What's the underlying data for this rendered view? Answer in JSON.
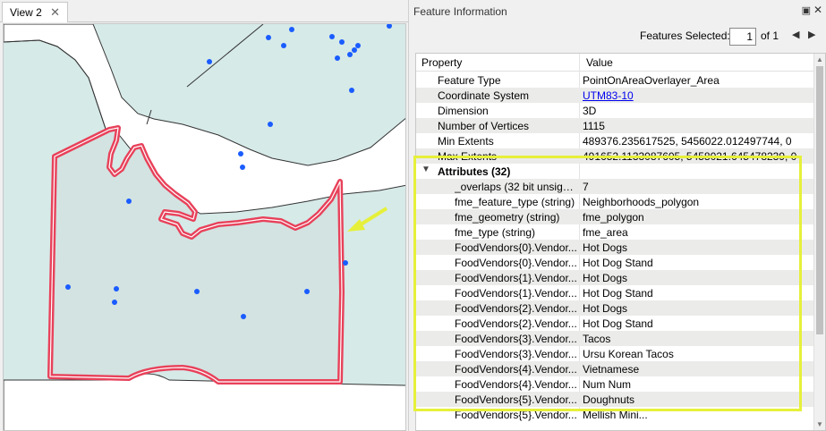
{
  "view": {
    "tab_label": "View 2",
    "close_glyph": "✕"
  },
  "panel": {
    "title": "Feature Information",
    "pin_glyph": "▣",
    "close_glyph": "✕",
    "features_selected_label": "Features Selected:",
    "features_selected_value": "1",
    "of_label": "of 1",
    "prev_glyph": "◀",
    "next_glyph": "▶",
    "icons": {
      "pin": "pin-icon",
      "close": "close-icon",
      "prev": "previous-icon",
      "next": "next-icon",
      "arrow": "arrow-icon"
    }
  },
  "table": {
    "col_property": "Property",
    "col_value": "Value",
    "rows": [
      {
        "key": "Feature Type",
        "value": "PointOnAreaOverlayer_Area"
      },
      {
        "key": "Coordinate System",
        "value": "UTM83-10"
      },
      {
        "key": "Dimension",
        "value": "3D"
      },
      {
        "key": "Number of Vertices",
        "value": "1115"
      },
      {
        "key": "Min Extents",
        "value": "489376.235617525, 5456022.012497744, 0"
      },
      {
        "key": "Max Extents",
        "value": "491652.1133087605, 5458021.645478239, 0"
      }
    ],
    "attributes_group": "Attributes (32)",
    "attributes": [
      {
        "key": "_overlaps (32 bit unsign...",
        "value": "7"
      },
      {
        "key": "fme_feature_type (string)",
        "value": "Neighborhoods_polygon"
      },
      {
        "key": "fme_geometry (string)",
        "value": "fme_polygon"
      },
      {
        "key": "fme_type (string)",
        "value": "fme_area"
      },
      {
        "key": "FoodVendors{0}.Vendor...",
        "value": "Hot Dogs"
      },
      {
        "key": "FoodVendors{0}.Vendor...",
        "value": "Hot Dog Stand"
      },
      {
        "key": "FoodVendors{1}.Vendor...",
        "value": "Hot Dogs"
      },
      {
        "key": "FoodVendors{1}.Vendor...",
        "value": "Hot Dog Stand"
      },
      {
        "key": "FoodVendors{2}.Vendor...",
        "value": "Hot Dogs"
      },
      {
        "key": "FoodVendors{2}.Vendor...",
        "value": "Hot Dog Stand"
      },
      {
        "key": "FoodVendors{3}.Vendor...",
        "value": "Tacos"
      },
      {
        "key": "FoodVendors{3}.Vendor...",
        "value": "Ursu Korean Tacos"
      },
      {
        "key": "FoodVendors{4}.Vendor...",
        "value": "Vietnamese"
      },
      {
        "key": "FoodVendors{4}.Vendor...",
        "value": "Num Num"
      },
      {
        "key": "FoodVendors{5}.Vendor...",
        "value": "Doughnuts"
      },
      {
        "key": "FoodVendors{5}.Vendor...",
        "value": "Mellish Mini..."
      }
    ]
  },
  "colors": {
    "land": "#d6eae8",
    "water": "#ffffff",
    "polygon_outline": "#e8415a",
    "polygon_fill": "#d3e3e1",
    "point": "#1a5cff",
    "highlight": "#e6f03a",
    "arrow": "#e6f03a"
  }
}
